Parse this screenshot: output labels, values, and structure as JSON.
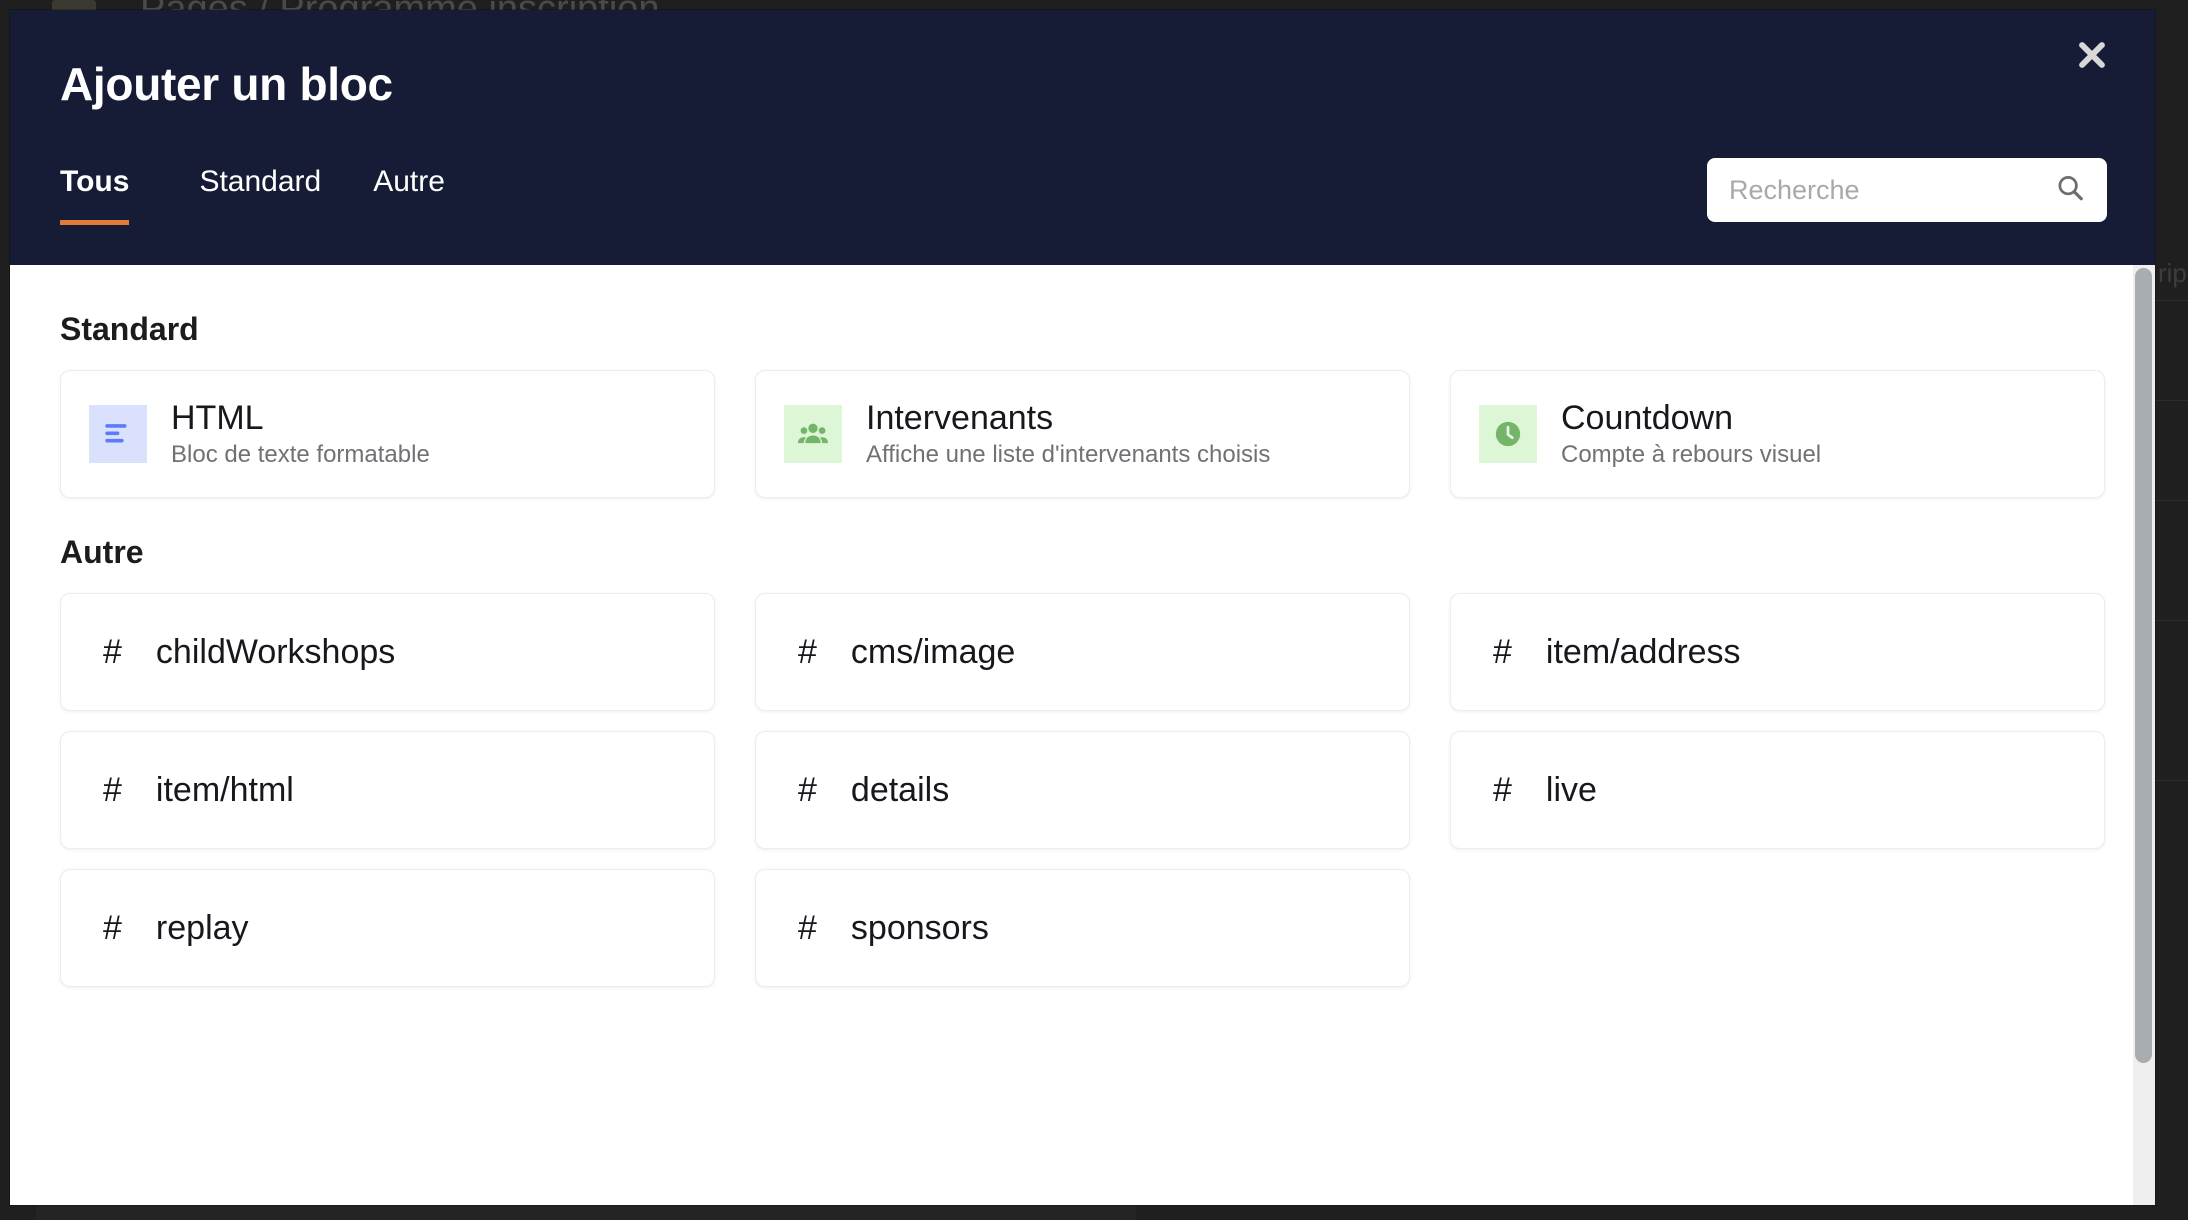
{
  "backdrop": {
    "breadcrumb": "Pages / Programme inscription",
    "right_label": "rip"
  },
  "modal": {
    "title": "Ajouter un bloc",
    "close_label": "✕",
    "close_icon": "close-icon"
  },
  "tabs": [
    {
      "label": "Tous",
      "active": true
    },
    {
      "label": "Standard",
      "active": false
    },
    {
      "label": "Autre",
      "active": false
    }
  ],
  "search": {
    "placeholder": "Recherche",
    "value": "",
    "icon": "search-icon"
  },
  "sections": {
    "standard": {
      "title": "Standard",
      "items": [
        {
          "name": "HTML",
          "description": "Bloc de texte formatable",
          "icon": "text-align-icon",
          "icon_bg": "#d9e1fd",
          "icon_color": "#5c7cfa"
        },
        {
          "name": "Intervenants",
          "description": "Affiche une liste d'intervenants choisis",
          "icon": "group-people-icon",
          "icon_bg": "#ddf7d6",
          "icon_color": "#74b56a"
        },
        {
          "name": "Countdown",
          "description": "Compte à rebours visuel",
          "icon": "clock-icon",
          "icon_bg": "#ddf7d6",
          "icon_color": "#74b56a"
        }
      ]
    },
    "autre": {
      "title": "Autre",
      "items": [
        {
          "name": "childWorkshops",
          "icon": "hash-icon"
        },
        {
          "name": "cms/image",
          "icon": "hash-icon"
        },
        {
          "name": "item/address",
          "icon": "hash-icon"
        },
        {
          "name": "item/html",
          "icon": "hash-icon"
        },
        {
          "name": "details",
          "icon": "hash-icon"
        },
        {
          "name": "live",
          "icon": "hash-icon"
        },
        {
          "name": "replay",
          "icon": "hash-icon"
        },
        {
          "name": "sponsors",
          "icon": "hash-icon"
        }
      ]
    }
  },
  "colors": {
    "header_bg": "#161c36",
    "accent_orange": "#e07b39",
    "card_border": "#ececf1",
    "scrollbar_thumb": "#aaadb0"
  }
}
